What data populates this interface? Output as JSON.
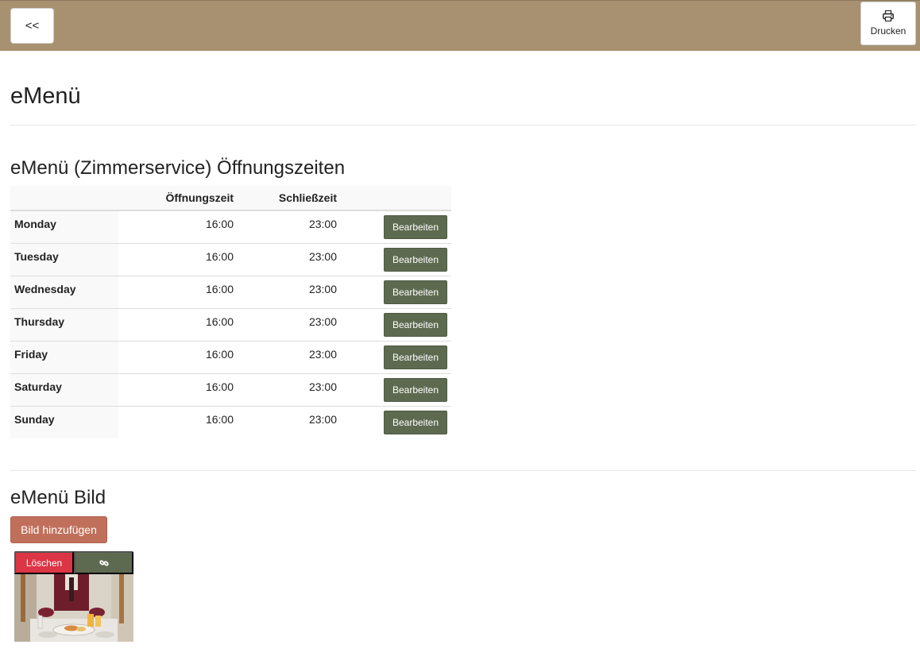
{
  "topbar": {
    "back_label": "<<",
    "print_label": "Drucken",
    "print_icon": "printer-icon",
    "background_color": "#a79170"
  },
  "page": {
    "title": "eMenü"
  },
  "hours_section": {
    "title": "eMenü (Zimmerservice) Öffnungszeiten",
    "columns": [
      "",
      "Öffnungszeit",
      "Schließzeit",
      ""
    ],
    "rows": [
      {
        "day": "Monday",
        "open": "16:00",
        "close": "23:00",
        "action": "Bearbeiten"
      },
      {
        "day": "Tuesday",
        "open": "16:00",
        "close": "23:00",
        "action": "Bearbeiten"
      },
      {
        "day": "Wednesday",
        "open": "16:00",
        "close": "23:00",
        "action": "Bearbeiten"
      },
      {
        "day": "Thursday",
        "open": "16:00",
        "close": "23:00",
        "action": "Bearbeiten"
      },
      {
        "day": "Friday",
        "open": "16:00",
        "close": "23:00",
        "action": "Bearbeiten"
      },
      {
        "day": "Saturday",
        "open": "16:00",
        "close": "23:00",
        "action": "Bearbeiten"
      },
      {
        "day": "Sunday",
        "open": "16:00",
        "close": "23:00",
        "action": "Bearbeiten"
      }
    ],
    "edit_button_color": "#5e6a50"
  },
  "image_section": {
    "title": "eMenü Bild",
    "add_label": "Bild hinzufügen",
    "add_button_color": "#c0705a",
    "image_card": {
      "delete_label": "Löschen",
      "delete_color": "#dc3545",
      "link_icon": "link-icon"
    }
  }
}
